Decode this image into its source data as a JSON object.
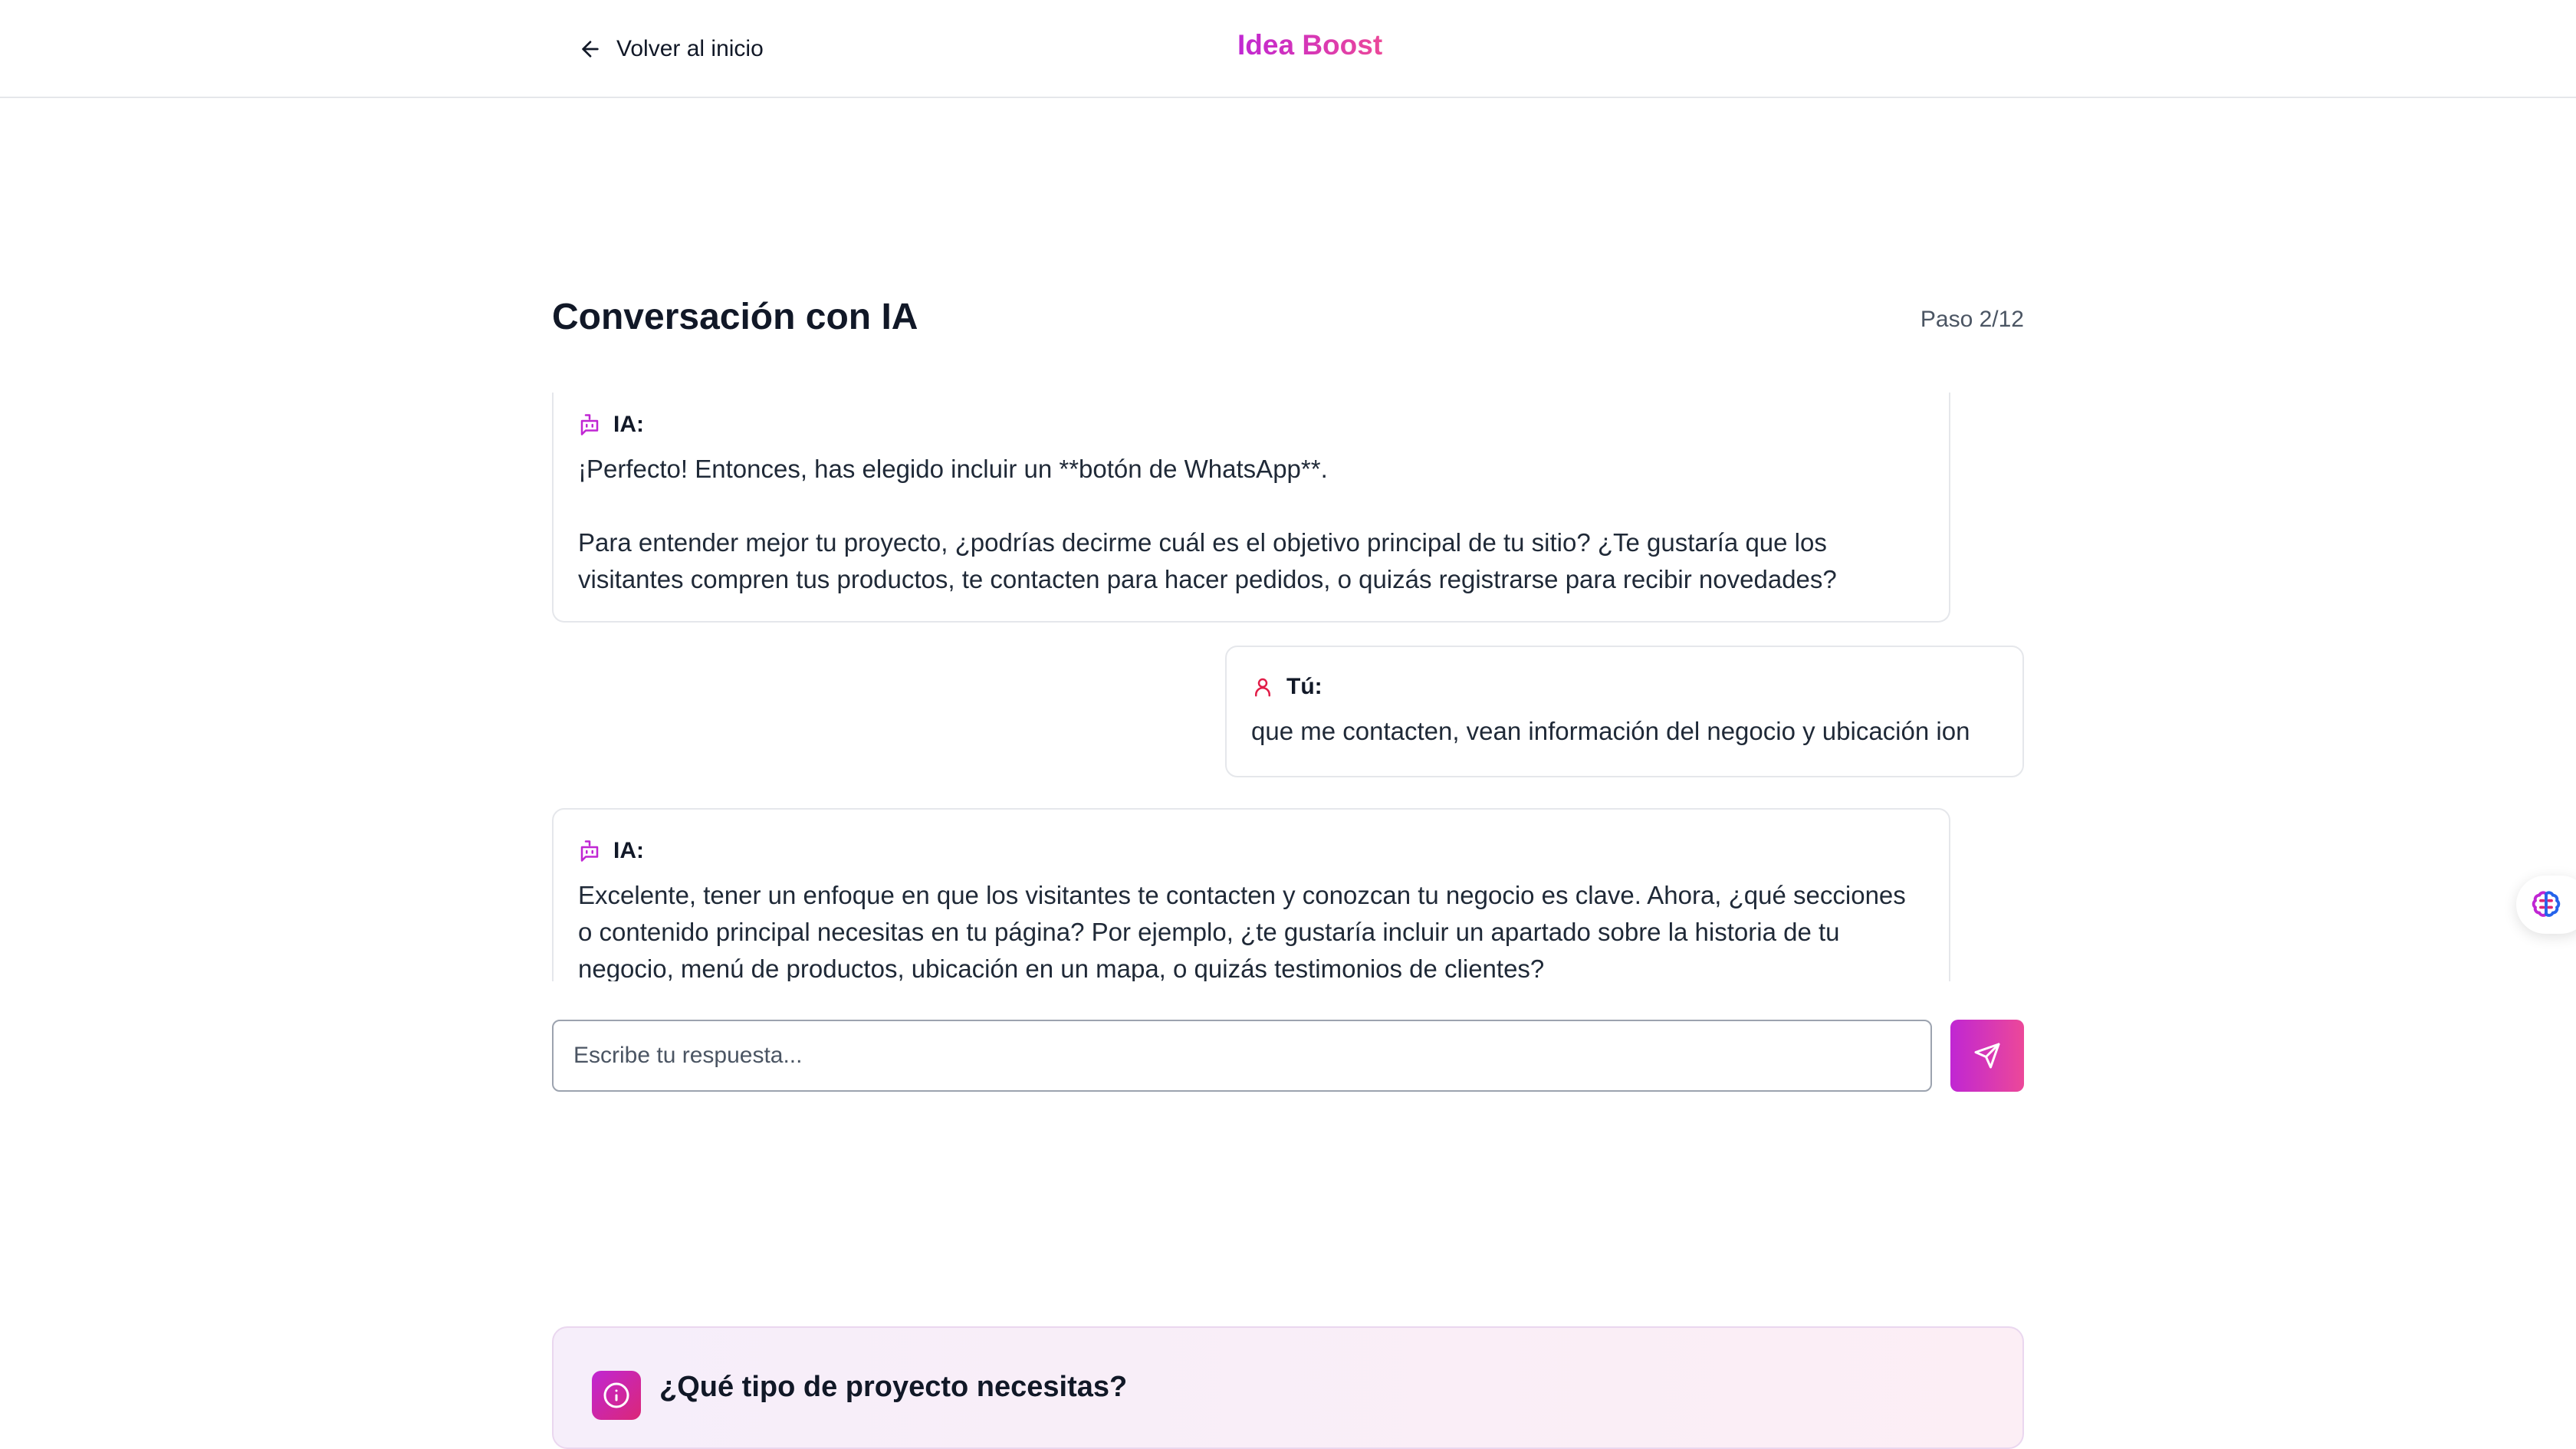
{
  "header": {
    "back_label": "Volver al inicio",
    "brand": "Idea Boost"
  },
  "page": {
    "title": "Conversación con IA",
    "step": "Paso 2/12"
  },
  "messages": [
    {
      "sender": "IA:",
      "paragraphs": [
        "¡Perfecto! Entonces, has elegido incluir un **botón de WhatsApp**.",
        "Para entender mejor tu proyecto, ¿podrías decirme cuál es el objetivo principal de tu sitio? ¿Te gustaría que los visitantes compren tus productos, te contacten para hacer pedidos, o quizás registrarse para recibir novedades?"
      ]
    },
    {
      "sender": "Tú:",
      "paragraphs": [
        "que me contacten, vean información del negocio y ubicación ion"
      ]
    },
    {
      "sender": "IA:",
      "paragraphs": [
        "Excelente, tener un enfoque en que los visitantes te contacten y conozcan tu negocio es clave. Ahora, ¿qué secciones o contenido principal necesitas en tu página? Por ejemplo, ¿te gustaría incluir un apartado sobre la historia de tu negocio, menú de productos, ubicación en un mapa, o quizás testimonios de clientes?"
      ]
    }
  ],
  "input": {
    "placeholder": "Escribe tu respuesta...",
    "value": ""
  },
  "info_card": {
    "title": "¿Qué tipo de proyecto necesitas?"
  },
  "colors": {
    "accent_start": "#c026d3",
    "accent_end": "#ec4899",
    "user_icon": "#e11d48"
  },
  "icons": {
    "back": "arrow-left-icon",
    "ai": "bot-message-icon",
    "user": "user-icon",
    "send": "send-icon",
    "floating": "brain-icon",
    "info": "info-icon"
  }
}
